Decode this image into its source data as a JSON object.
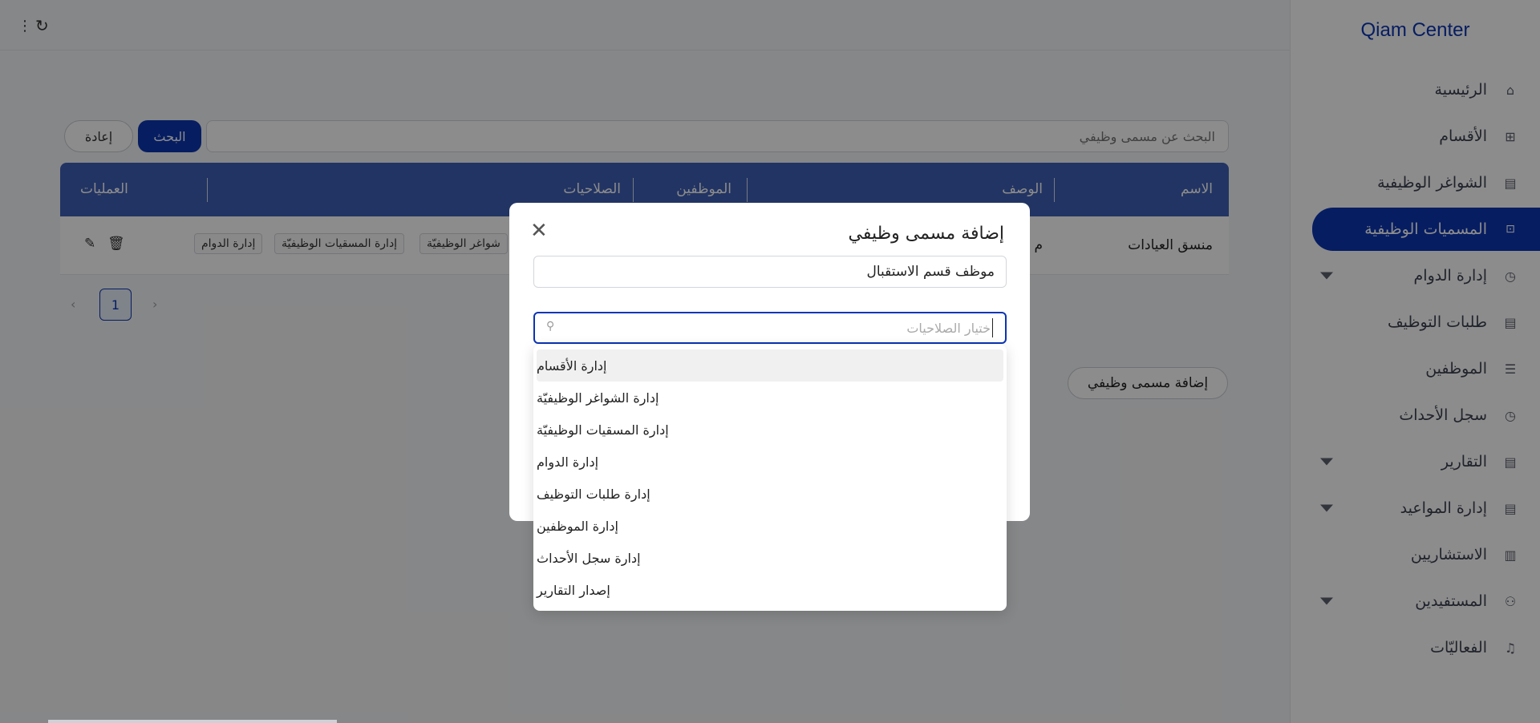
{
  "sidebar": {
    "brand": "Qiam Center",
    "items": [
      {
        "label": "الرئيسية",
        "icon": "home-icon",
        "glyph": "⌂"
      },
      {
        "label": "الأقسام",
        "icon": "sitemap-icon",
        "glyph": "⊞"
      },
      {
        "label": "الشواغر الوظيفية",
        "icon": "briefcase-icon",
        "glyph": "▤"
      },
      {
        "label": "المسميات الوظيفية",
        "icon": "lock-icon",
        "glyph": "🔒"
      },
      {
        "label": "إدارة الدوام",
        "icon": "clock-icon",
        "glyph": "◷"
      },
      {
        "label": "طلبات التوظيف",
        "icon": "document-icon",
        "glyph": "▤"
      },
      {
        "label": "الموظفين",
        "icon": "list-icon",
        "glyph": "☰"
      },
      {
        "label": "سجل الأحداث",
        "icon": "history-icon",
        "glyph": "◷"
      },
      {
        "label": "التقارير",
        "icon": "report-icon",
        "glyph": "▤"
      },
      {
        "label": "إدارة المواعيد",
        "icon": "calendar-icon",
        "glyph": "▤"
      },
      {
        "label": "الاستشاريين",
        "icon": "chart-icon",
        "glyph": "▥"
      },
      {
        "label": "المستفيدين",
        "icon": "users-icon",
        "glyph": "⚇"
      },
      {
        "label": "الفعاليّات",
        "icon": "bell-icon",
        "glyph": "♫"
      }
    ]
  },
  "toolbar": {
    "reset_label": "إعادة",
    "search_label": "البحث",
    "search_placeholder": "البحث عن مسمى وظيفي"
  },
  "table": {
    "columns": [
      "الاسم",
      "الوصف",
      "الموظفين",
      "الصلاحيات",
      "العمليات"
    ],
    "rows": [
      {
        "name": "منسق العيادات",
        "description_fragment": "م",
        "permissions": [
          "إدارة الدوام",
          "إدارة المسقيات الوظيفيّة",
          "شواغر الوظيفيّة"
        ]
      }
    ]
  },
  "pagination": {
    "current": "1"
  },
  "add_button": "إضافة مسمى وظيفي",
  "modal": {
    "title": "إضافة مسمى وظيفي",
    "name_value": "موظف قسم الاستقبال",
    "permissions_placeholder": "ختيار الصلاحيات",
    "options": [
      "إدارة الأقسام",
      "إدارة الشواغر الوظيفيّة",
      "إدارة المسقيات الوظيفيّة",
      "إدارة الدوام",
      "إدارة طلبات التوظيف",
      "إدارة الموظفين",
      "إدارة سجل الأحداث",
      "إصدار التقارير"
    ]
  },
  "colors": {
    "primary": "#0b35b3",
    "table_header": "#3f5fb4",
    "overlay": "rgba(0,0,0,0.45)"
  }
}
